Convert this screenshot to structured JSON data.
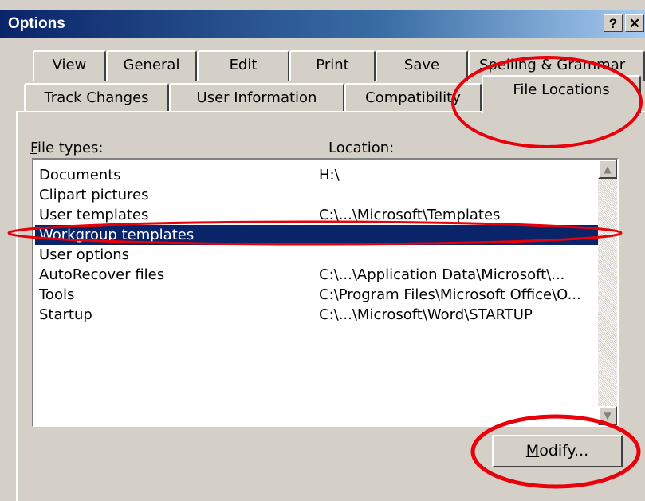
{
  "window": {
    "title": "Options",
    "help_label": "?",
    "close_label": "✕"
  },
  "tabs_back": [
    {
      "label": "View"
    },
    {
      "label": "General"
    },
    {
      "label": "Edit"
    },
    {
      "label": "Print"
    },
    {
      "label": "Save"
    },
    {
      "label": "Spelling & Grammar"
    }
  ],
  "tabs_front": [
    {
      "label": "Track Changes"
    },
    {
      "label": "User Information"
    },
    {
      "label": "Compatibility"
    },
    {
      "label": "File Locations",
      "active": true
    }
  ],
  "list": {
    "file_types_label": "File types:",
    "location_label": "Location:",
    "rows": [
      {
        "type": "Documents",
        "location": "H:\\"
      },
      {
        "type": "Clipart pictures",
        "location": ""
      },
      {
        "type": "User templates",
        "location": "C:\\...\\Microsoft\\Templates"
      },
      {
        "type": "Workgroup templates",
        "location": "",
        "selected": true
      },
      {
        "type": "User options",
        "location": ""
      },
      {
        "type": "AutoRecover files",
        "location": "C:\\...\\Application Data\\Microsoft\\..."
      },
      {
        "type": "Tools",
        "location": "C:\\Program Files\\Microsoft Office\\O..."
      },
      {
        "type": "Startup",
        "location": "C:\\...\\Microsoft\\Word\\STARTUP"
      }
    ]
  },
  "buttons": {
    "modify_label": "Modify..."
  },
  "colors": {
    "selection": "#0a246a",
    "annotation": "#e8000b",
    "face": "#d4d0c8"
  },
  "icons": {
    "scroll_up": "scroll-up-arrow-icon",
    "scroll_down": "scroll-down-arrow-icon"
  }
}
